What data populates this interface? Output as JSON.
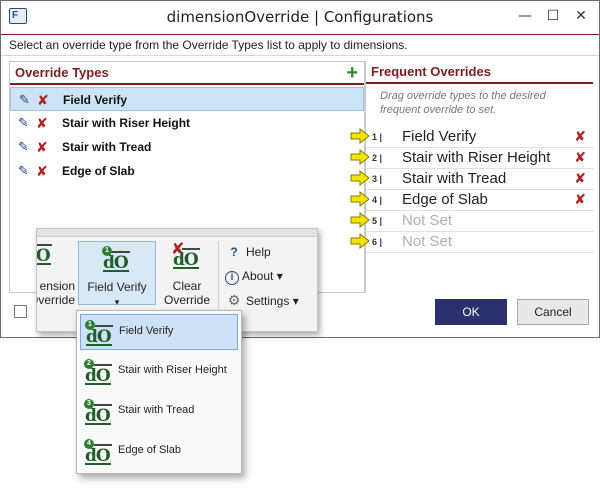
{
  "window": {
    "title": "dimensionOverride | Configurations",
    "app_icon_text": "F",
    "minimize": "—",
    "maximize": "☐",
    "close": "✕",
    "instructions": "Select an override type from the Override Types list to apply to dimensions."
  },
  "override_types": {
    "header": "Override Types",
    "add_glyph": "+",
    "items": [
      {
        "label": "Field Verify",
        "selected": true
      },
      {
        "label": "Stair with Riser Height",
        "selected": false
      },
      {
        "label": "Stair with Tread",
        "selected": false
      },
      {
        "label": "Edge of Slab",
        "selected": false
      }
    ]
  },
  "frequent_overrides": {
    "header": "Frequent Overrides",
    "hint": "Drag override types to the desired frequent override to set.",
    "slots": [
      {
        "num": "1 |",
        "label": "Field Verify",
        "set": true
      },
      {
        "num": "2 |",
        "label": "Stair with Riser Height",
        "set": true
      },
      {
        "num": "3 |",
        "label": "Stair with Tread",
        "set": true
      },
      {
        "num": "4 |",
        "label": "Edge of Slab",
        "set": true
      },
      {
        "num": "5 |",
        "label": "Not Set",
        "set": false
      },
      {
        "num": "6 |",
        "label": "Not Set",
        "set": false
      }
    ]
  },
  "buttons": {
    "ok": "OK",
    "cancel": "Cancel"
  },
  "ribbon": {
    "dimension_override_label": "ension\nOverride",
    "field_verify_label": "Field Verify",
    "field_verify_caret": "▾",
    "clear_override_label": "Clear\nOverride",
    "help_label": "Help",
    "about_label": "About ▾",
    "settings_label": "Settings ▾"
  },
  "menu": {
    "items": [
      {
        "num": "1",
        "label": "Field Verify",
        "active": true
      },
      {
        "num": "2",
        "label": "Stair with Riser Height",
        "active": false
      },
      {
        "num": "3",
        "label": "Stair with Tread",
        "active": false
      },
      {
        "num": "4",
        "label": "Edge of Slab",
        "active": false
      }
    ]
  },
  "icon_text": "dO",
  "colors": {
    "accent": "#7a1f1f",
    "ok_button": "#2b2f6e",
    "selection": "#cde4f7",
    "delete_x": "#b02020",
    "add_plus": "#2e8b2e",
    "arrow_yellow": "#f5e400"
  }
}
